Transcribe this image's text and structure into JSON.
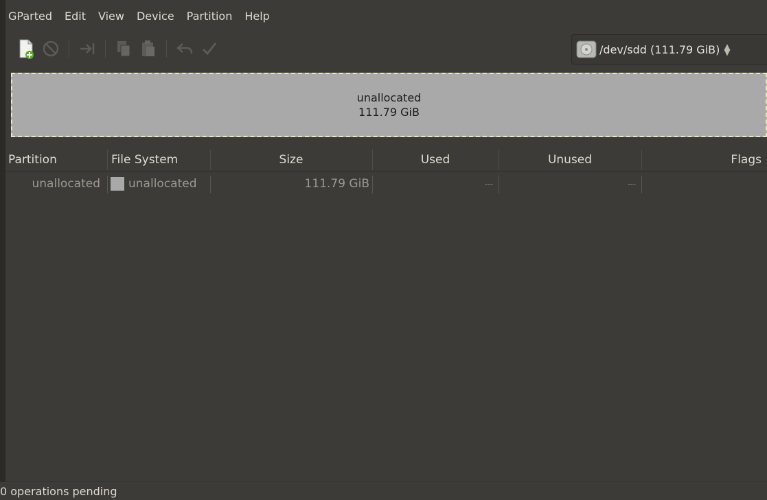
{
  "menubar": {
    "items": [
      "GParted",
      "Edit",
      "View",
      "Device",
      "Partition",
      "Help"
    ]
  },
  "toolbar": {
    "buttons": [
      {
        "name": "new-partition",
        "icon": "new-document-icon",
        "enabled": true
      },
      {
        "name": "delete-partition",
        "icon": "no-entry-icon",
        "enabled": false
      },
      {
        "name": "resize-move",
        "icon": "arrow-right-bar-icon",
        "enabled": false
      },
      {
        "name": "copy",
        "icon": "copy-icon",
        "enabled": false
      },
      {
        "name": "paste",
        "icon": "paste-icon",
        "enabled": false
      },
      {
        "name": "undo",
        "icon": "undo-icon",
        "enabled": false
      },
      {
        "name": "apply",
        "icon": "checkmark-icon",
        "enabled": false
      }
    ]
  },
  "device": {
    "label": "/dev/sdd  (111.79 GiB)",
    "icon": "harddisk-icon"
  },
  "partition_map": {
    "name": "unallocated",
    "size": "111.79 GiB",
    "fill_color": "#a9a9a9"
  },
  "table": {
    "columns": [
      "Partition",
      "File System",
      "Size",
      "Used",
      "Unused",
      "Flags"
    ],
    "rows": [
      {
        "partition": "unallocated",
        "file_system": "unallocated",
        "size": "111.79 GiB",
        "used": "---",
        "unused": "---",
        "flags": ""
      }
    ]
  },
  "status": {
    "text": "0 operations pending"
  },
  "colors": {
    "window_bg": "#3c3b37",
    "text": "#dfdbd2",
    "dimmed_text": "#9c9891",
    "unallocated": "#a9a9a9",
    "selection_dash": "#e8e8b8"
  }
}
